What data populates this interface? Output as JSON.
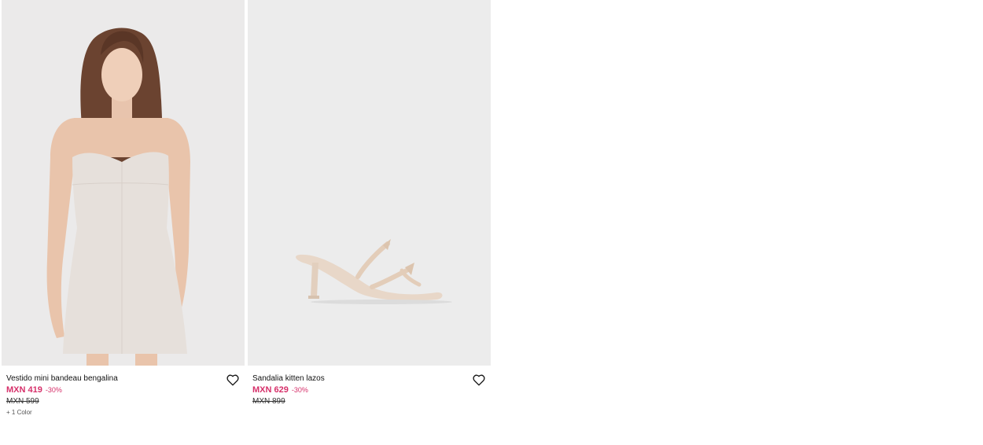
{
  "products": [
    {
      "name": "Vestido mini bandeau bengalina",
      "price": "MXN 419",
      "discount": "-30%",
      "old_price": "MXN 599",
      "colors": "+ 1 Color",
      "image": "model-wearing-white-strapless-mini-dress",
      "favorite_icon": "heart-outline-icon"
    },
    {
      "name": "Sandalia kitten lazos",
      "price": "MXN 629",
      "discount": "-30%",
      "old_price": "MXN 899",
      "image": "beige-kitten-heel-sandal-with-bows",
      "favorite_icon": "heart-outline-icon"
    }
  ],
  "colors": {
    "sale": "#d6306a",
    "image_background": "#ececec"
  }
}
